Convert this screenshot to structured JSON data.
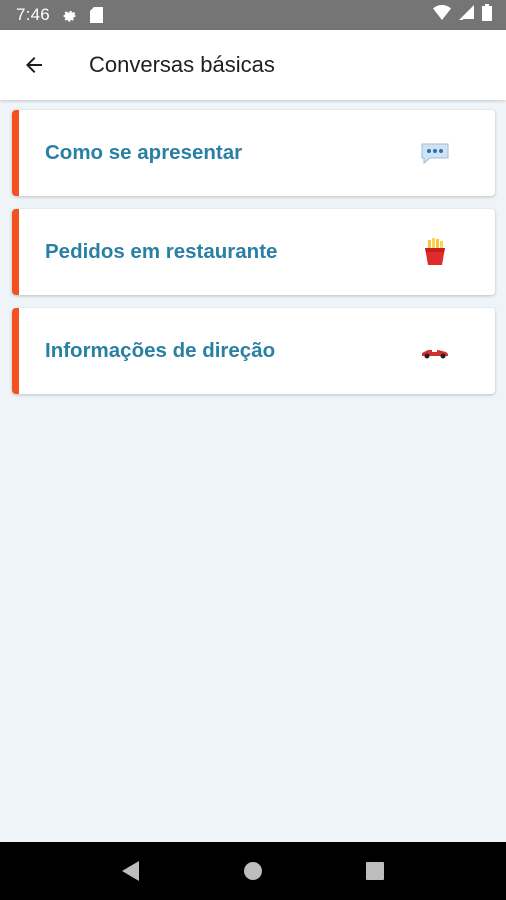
{
  "status_bar": {
    "time": "7:46",
    "icons": [
      "settings-icon",
      "sd-card-icon",
      "wifi-icon",
      "signal-icon",
      "battery-icon"
    ]
  },
  "app_bar": {
    "back_icon": "arrow-left-icon",
    "title": "Conversas básicas"
  },
  "topics": [
    {
      "label": "Como se apresentar",
      "icon": "speech-bubble-icon"
    },
    {
      "label": "Pedidos em restaurante",
      "icon": "french-fries-icon"
    },
    {
      "label": "Informações de direção",
      "icon": "race-car-icon"
    }
  ],
  "nav_bar": {
    "buttons": [
      "back-triangle-icon",
      "home-circle-icon",
      "recents-square-icon"
    ]
  },
  "colors": {
    "accent": "#f4511e",
    "label": "#2a80a4",
    "background": "#eef4f8",
    "status_bar": "#757575"
  }
}
